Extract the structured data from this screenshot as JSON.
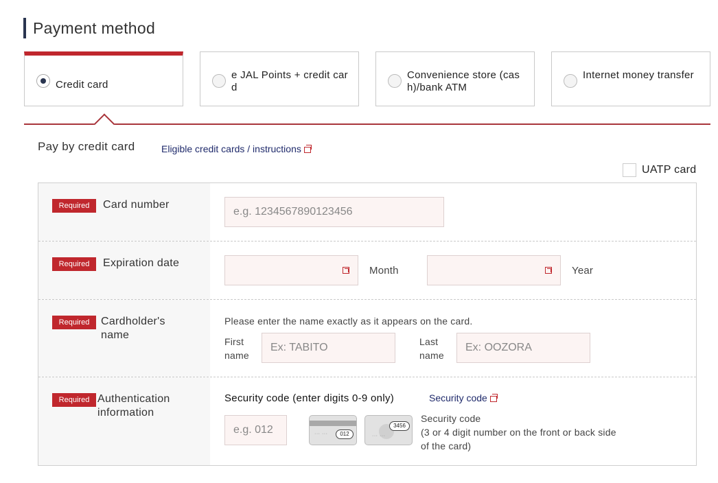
{
  "section_title": "Payment method",
  "tabs": [
    {
      "label": "Credit card",
      "selected": true
    },
    {
      "label": "e JAL Points + credit card",
      "selected": false
    },
    {
      "label": "Convenience store (cash)/bank ATM",
      "selected": false
    },
    {
      "label": "Internet money transfer",
      "selected": false
    }
  ],
  "pay_section": {
    "title": "Pay by credit card",
    "eligible_link": "Eligible credit cards / instructions"
  },
  "uatp": {
    "label": "UATP card",
    "checked": false
  },
  "required_badge": "Required",
  "card_number": {
    "label": "Card number",
    "placeholder": "e.g. 1234567890123456"
  },
  "expiration": {
    "label": "Expiration date",
    "month_label": "Month",
    "year_label": "Year"
  },
  "cardholder": {
    "label": "Cardholder's name",
    "note": "Please enter the name exactly as it appears on the card.",
    "first_label": "First name",
    "first_placeholder": "Ex: TABITO",
    "last_label": "Last name",
    "last_placeholder": "Ex: OOZORA"
  },
  "auth": {
    "label": "Authentication information",
    "security_title": "Security code (enter digits 0-9 only)",
    "security_link": "Security code",
    "placeholder": "e.g. 012",
    "card_back_code": "012",
    "card_front_code": "3456",
    "card_dots": "··· ···",
    "help_title": "Security code",
    "help_text": "(3 or 4 digit number on the front or back side of the card)"
  },
  "colors": {
    "accent_red": "#c0272d",
    "navy": "#2a3550",
    "input_bg": "#fcf4f3"
  }
}
